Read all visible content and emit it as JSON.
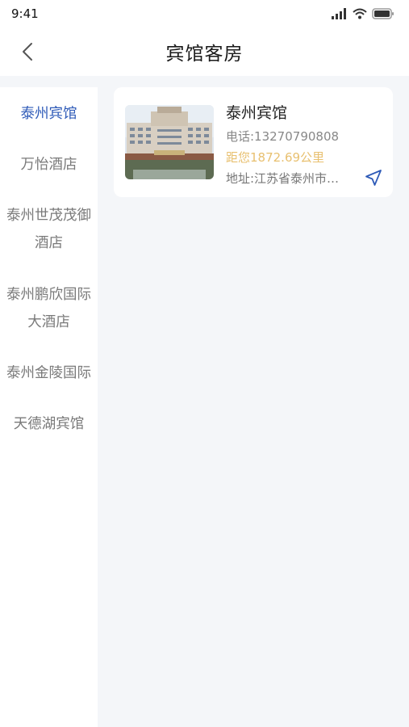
{
  "status_bar": {
    "time": "9:41"
  },
  "header": {
    "title": "宾馆客房"
  },
  "sidebar": {
    "items": [
      {
        "label": "泰州宾馆",
        "active": true
      },
      {
        "label": "万怡酒店",
        "active": false
      },
      {
        "label": "泰州世茂茂御酒店",
        "active": false
      },
      {
        "label": "泰州鹏欣国际大酒店",
        "active": false
      },
      {
        "label": "泰州金陵国际",
        "active": false
      },
      {
        "label": "天德湖宾馆",
        "active": false
      }
    ]
  },
  "hotels": [
    {
      "name": "泰州宾馆",
      "phone": "电话:13270790808",
      "distance": "距您1872.69公里",
      "address": "地址:江苏省泰州市…"
    }
  ],
  "colors": {
    "accent": "#2f5bb8",
    "distance": "#e8c070",
    "background": "#f4f6f9"
  }
}
